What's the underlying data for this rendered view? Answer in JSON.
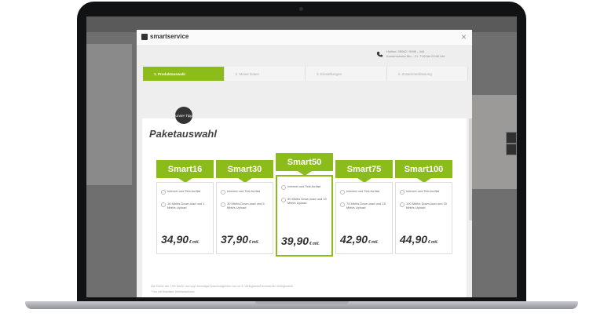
{
  "app": {
    "logo_text": "smartservice",
    "close_label": "×"
  },
  "contact": {
    "line1": "Hotline: 05062 / 9999 - 444",
    "line2": "Kundencenter Mo. - Fr. 7:00 bis 20:00 Uhr"
  },
  "steps": [
    {
      "label": "1. Produktauswahl"
    },
    {
      "label": "2. Meine Daten"
    },
    {
      "label": "3. Einstellungen"
    },
    {
      "label": "4. Zusammenfassung"
    }
  ],
  "page": {
    "title": "Paketauswahl",
    "badge": "Unser Tipp"
  },
  "packages": [
    {
      "name": "Smart16",
      "feat1": "Internet und Tele-fonflat",
      "feat2": "16 Mbit/s Down-load und 1 Mbit/s Upload",
      "price": "34,90",
      "currency": "€",
      "unit": "mtl."
    },
    {
      "name": "Smart30",
      "feat1": "Internet und Tele-fonflat",
      "feat2": "30 Mbit/s Down-load und 5 Mbit/s Upload",
      "price": "37,90",
      "currency": "€",
      "unit": "mtl."
    },
    {
      "name": "Smart50",
      "feat1": "Internet und Tele-fonflat",
      "feat2": "50 Mbit/s Down-load und 10 Mbit/s Upload",
      "price": "39,90",
      "currency": "€",
      "unit": "mtl."
    },
    {
      "name": "Smart75",
      "feat1": "Internet und Tele-fonflat",
      "feat2": "75 Mbit/s Down-load und 15 Mbit/s Upload",
      "price": "42,90",
      "currency": "€",
      "unit": "mtl."
    },
    {
      "name": "Smart100",
      "feat1": "Internet und Tele-fonflat",
      "feat2": "100 Mbit/s Down-load und 20 Mbit/s Upload",
      "price": "44,90",
      "currency": "€",
      "unit": "mtl."
    }
  ],
  "footnotes": [
    "Alle Preise inkl. 19% MwSt. und zzgl. einmaliger Anschlussgebühr von ca. €. Verfügbarkeit technischer Verfügbarkeit.",
    "* Nur mit Glasfaser-Direktanschluss."
  ],
  "colors": {
    "accent": "#8cbc1a",
    "dark": "#333333",
    "screen_bg": "#6f6f6f"
  }
}
